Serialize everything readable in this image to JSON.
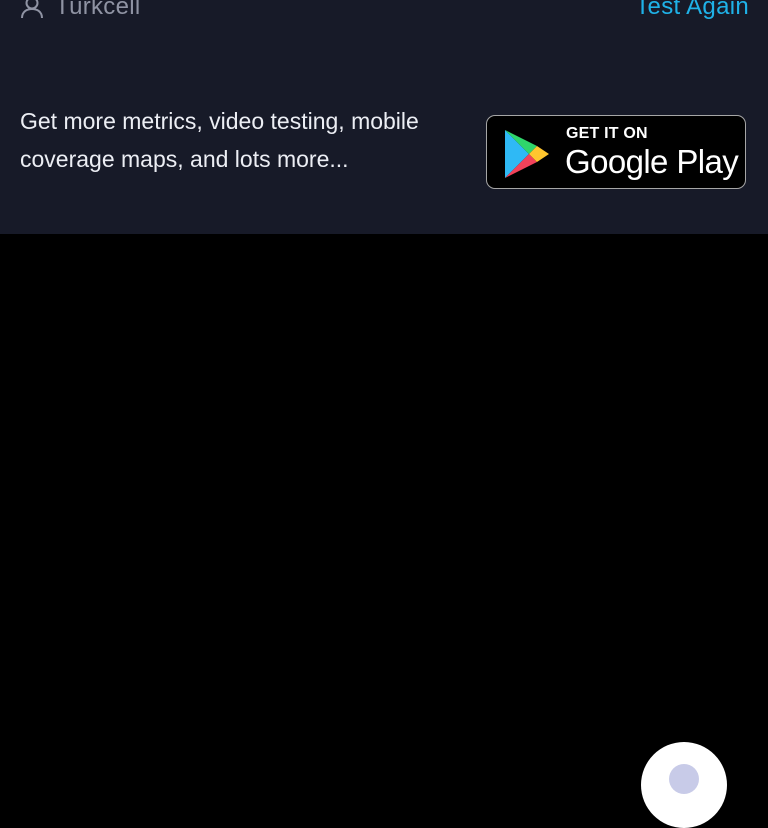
{
  "header": {
    "provider_icon": "user-icon",
    "provider_name": "Turkcell",
    "test_again_label": "Test Again"
  },
  "promo": {
    "text": "Get more metrics, video testing, mobile coverage maps, and lots more...",
    "badge": {
      "small_text": "GET IT ON",
      "large_text": "Google Play",
      "logo": "google-play-logo"
    }
  },
  "fab": {
    "icon": "circle-icon"
  },
  "colors": {
    "panel_bg": "#171a28",
    "page_bg": "#000000",
    "accent": "#1fb2e8",
    "muted_text": "#8f93a3",
    "text": "#eceef4"
  }
}
